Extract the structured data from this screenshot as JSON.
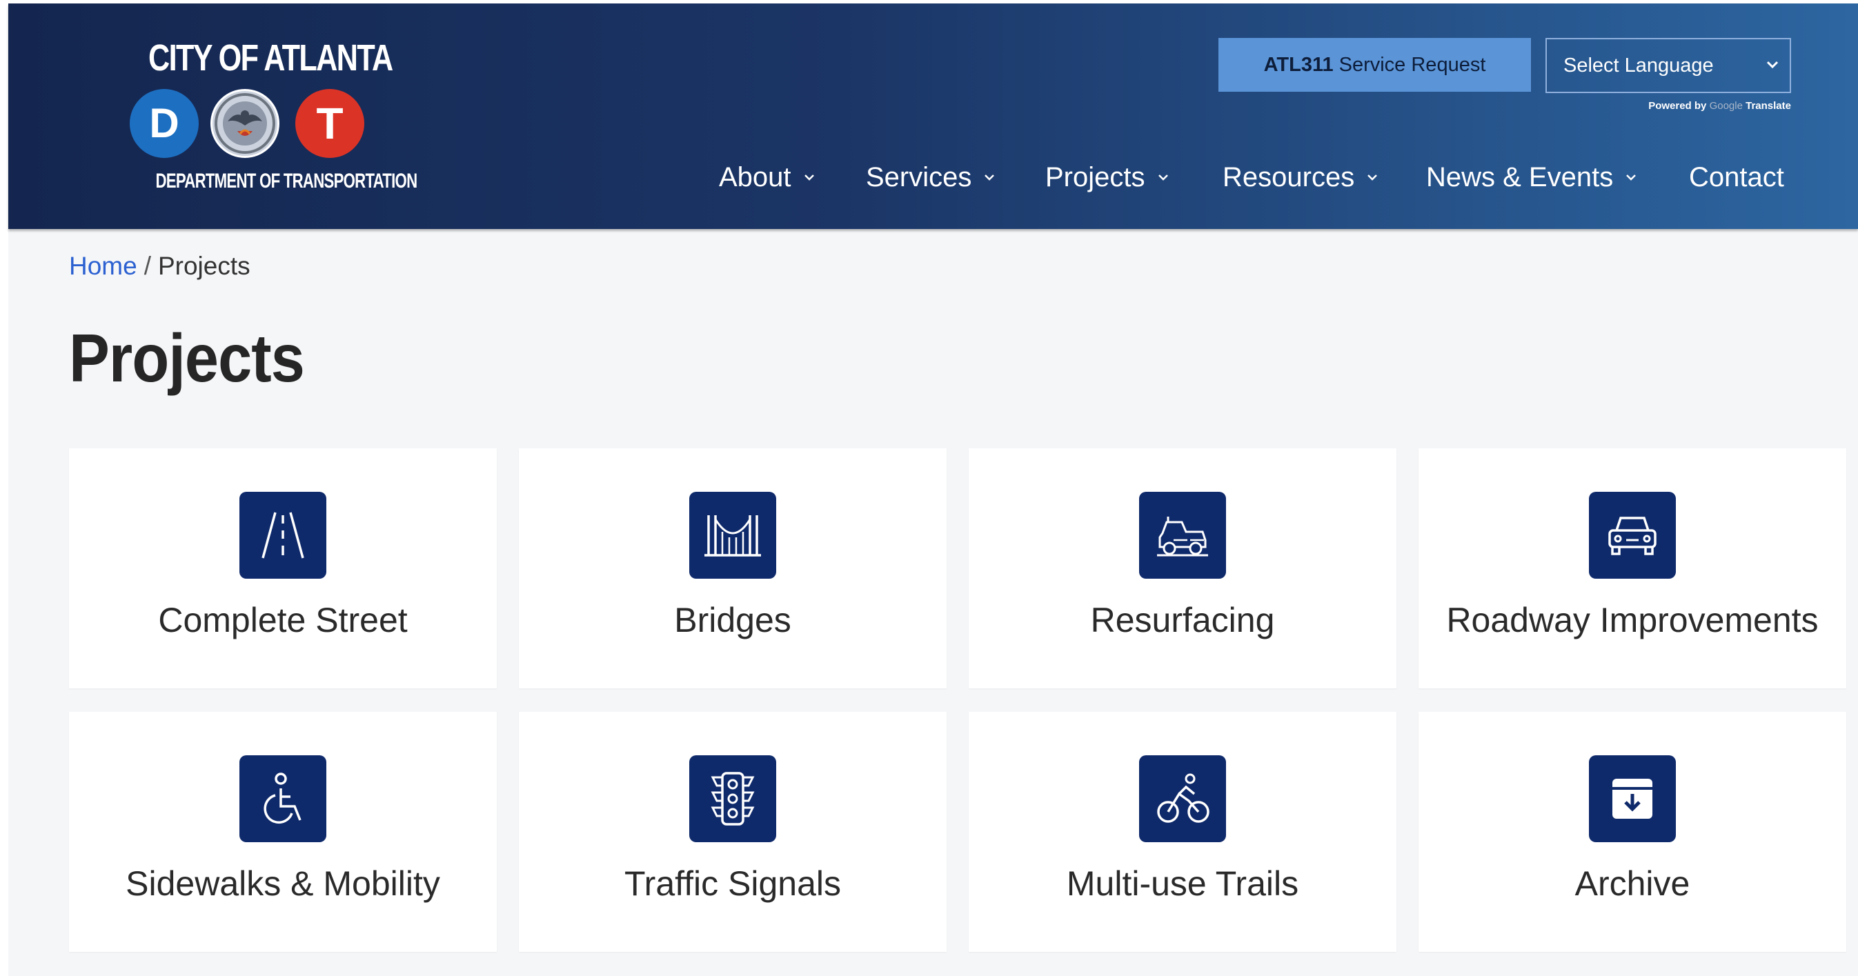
{
  "header": {
    "logo": {
      "title": "CITY OF ATLANTA",
      "letter_d": "D",
      "letter_t": "T",
      "subtitle": "DEPARTMENT OF TRANSPORTATION",
      "colors": {
        "d_circle": "#1d6fc2",
        "t_circle": "#dc3327"
      }
    },
    "service_button": {
      "bold": "ATL311",
      "text": "Service Request"
    },
    "language": {
      "selected": "Select Language",
      "powered_by": "Powered by",
      "google": "Google",
      "translate": "Translate"
    },
    "nav": [
      {
        "label": "About",
        "has_dropdown": true
      },
      {
        "label": "Services",
        "has_dropdown": true
      },
      {
        "label": "Projects",
        "has_dropdown": true
      },
      {
        "label": "Resources",
        "has_dropdown": true
      },
      {
        "label": "News & Events",
        "has_dropdown": true
      },
      {
        "label": "Contact",
        "has_dropdown": false
      }
    ]
  },
  "breadcrumb": {
    "home": "Home",
    "separator": "/",
    "current": "Projects"
  },
  "page_title": "Projects",
  "cards": [
    {
      "label": "Complete Street",
      "icon": "road-icon"
    },
    {
      "label": "Bridges",
      "icon": "bridge-icon"
    },
    {
      "label": "Resurfacing",
      "icon": "road-roller-icon"
    },
    {
      "label": "Roadway Improvements",
      "icon": "car-icon"
    },
    {
      "label": "Sidewalks & Mobility",
      "icon": "wheelchair-icon"
    },
    {
      "label": "Traffic Signals",
      "icon": "traffic-light-icon"
    },
    {
      "label": "Multi-use Trails",
      "icon": "bicycle-icon"
    },
    {
      "label": "Archive",
      "icon": "archive-icon"
    }
  ],
  "colors": {
    "header_start": "#14264f",
    "header_end": "#2d66a1",
    "service_button": "#5b95d8",
    "icon_tile": "#0f2a6b",
    "link": "#2c61d1",
    "page_bg": "#f5f6f8"
  }
}
